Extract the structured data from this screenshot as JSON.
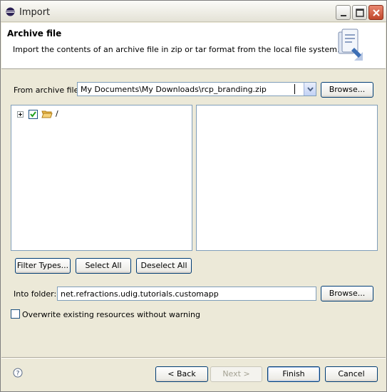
{
  "window": {
    "title": "Import"
  },
  "banner": {
    "title": "Archive file",
    "description": "Import the contents of an archive file in zip or tar format from the local file system."
  },
  "archive": {
    "label": "From archive file:",
    "value": "My Documents\\My Downloads\\rcp_branding.zip",
    "browse_label": "Browse..."
  },
  "tree": {
    "root_label": "/"
  },
  "buttons": {
    "filter_types": "Filter Types...",
    "select_all": "Select All",
    "deselect_all": "Deselect All"
  },
  "into_folder": {
    "label": "Into folder:",
    "value": "net.refractions.udig.tutorials.customapp",
    "browse_label": "Browse..."
  },
  "overwrite": {
    "label": "Overwrite existing resources without warning",
    "checked": false
  },
  "footer": {
    "back": "< Back",
    "next": "Next >",
    "finish": "Finish",
    "cancel": "Cancel"
  }
}
